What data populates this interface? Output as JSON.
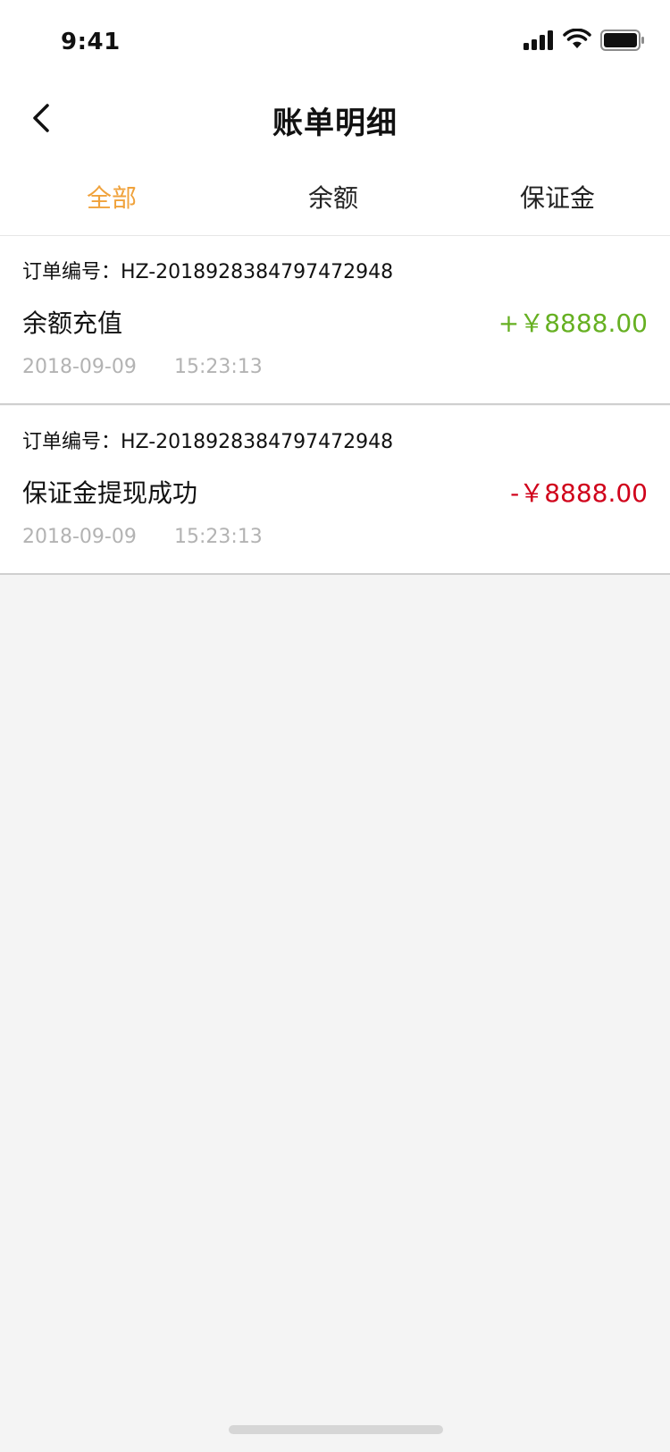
{
  "status_bar": {
    "time": "9:41"
  },
  "nav": {
    "title": "账单明细"
  },
  "tabs": [
    {
      "label": "全部",
      "active": true
    },
    {
      "label": "余额",
      "active": false
    },
    {
      "label": "保证金",
      "active": false
    }
  ],
  "records": [
    {
      "order_label": "订单编号：HZ-2018928384797472948",
      "title": "余额充值",
      "amount": "+￥8888.00",
      "amount_color": "#66b022",
      "date": "2018-09-09",
      "time": "15:23:13"
    },
    {
      "order_label": "订单编号：HZ-2018928384797472948",
      "title": "保证金提现成功",
      "amount": "-￥8888.00",
      "amount_color": "#d0021b",
      "date": "2018-09-09",
      "time": "15:23:13"
    }
  ],
  "colors": {
    "accent": "#f0a23b",
    "background": "#f4f4f4",
    "income": "#66b022",
    "expense": "#d0021b"
  },
  "icons": {
    "back": "chevron-left-icon",
    "signal": "cellular-signal-icon",
    "wifi": "wifi-icon",
    "battery": "battery-icon"
  }
}
